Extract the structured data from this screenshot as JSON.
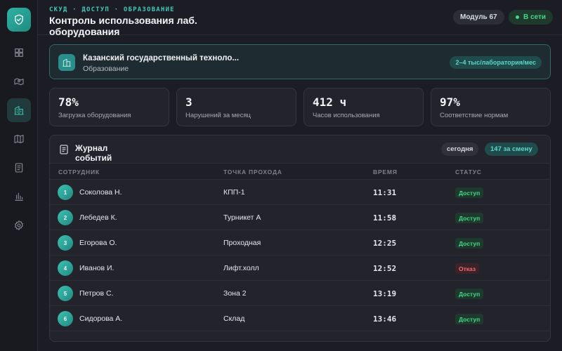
{
  "sidebar": {
    "logo_icon": "shield-check-icon",
    "items": [
      {
        "icon": "dashboard-icon",
        "active": false
      },
      {
        "icon": "map-pin-icon",
        "active": false
      },
      {
        "icon": "building-icon",
        "active": true
      },
      {
        "icon": "map-icon",
        "active": false
      },
      {
        "icon": "document-icon",
        "active": false
      },
      {
        "icon": "bar-chart-icon",
        "active": false
      },
      {
        "icon": "gear-icon",
        "active": false
      }
    ]
  },
  "header": {
    "breadcrumb": "СКУД · ДОСТУП · ОБРАЗОВАНИЕ",
    "title": "Контроль использования лаб. оборудования",
    "module_badge": "Модуль 67",
    "status_badge": "В сети"
  },
  "org": {
    "icon": "building-icon",
    "name": "Казанский государственный технолo...",
    "type": "Образование",
    "badge": "2–4 тыс/лаборатория/мес"
  },
  "stats": [
    {
      "value": "78%",
      "label": "Загрузка оборудования"
    },
    {
      "value": "3",
      "label": "Нарушений за месяц"
    },
    {
      "value": "412 ч",
      "label": "Часов использования"
    },
    {
      "value": "97%",
      "label": "Соответствие нормам"
    }
  ],
  "journal": {
    "title": "Журнал событий",
    "today_chip": "сегодня",
    "shift_chip": "147 за смену",
    "columns": [
      "СОТРУДНИК",
      "ТОЧКА ПРОХОДА",
      "ВРЕМЯ",
      "СТАТУС"
    ],
    "rows": [
      {
        "n": "1",
        "name": "Соколова Н.",
        "point": "КПП-1",
        "time": "11:31",
        "status": "Доступ",
        "granted": true
      },
      {
        "n": "2",
        "name": "Лебедев К.",
        "point": "Турникет А",
        "time": "11:58",
        "status": "Доступ",
        "granted": true
      },
      {
        "n": "3",
        "name": "Егорова О.",
        "point": "Проходная",
        "time": "12:25",
        "status": "Доступ",
        "granted": true
      },
      {
        "n": "4",
        "name": "Иванов И.",
        "point": "Лифт.холл",
        "time": "12:52",
        "status": "Отказ",
        "granted": false
      },
      {
        "n": "5",
        "name": "Петров С.",
        "point": "Зона 2",
        "time": "13:19",
        "status": "Доступ",
        "granted": true
      },
      {
        "n": "6",
        "name": "Сидорова А.",
        "point": "Склад",
        "time": "13:46",
        "status": "Доступ",
        "granted": true
      }
    ]
  },
  "colors": {
    "accent": "#3fc7b7",
    "granted": "#4ad58a",
    "denied": "#f06b78",
    "background": "#1c1d24"
  }
}
